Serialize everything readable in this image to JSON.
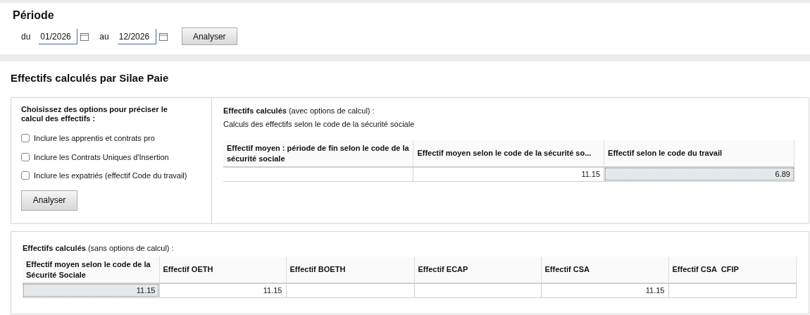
{
  "period": {
    "title": "Période",
    "from_label": "du",
    "from_value": "01/2026",
    "to_label": "au",
    "to_value": "12/2026",
    "button": "Analyser"
  },
  "section_title": "Effectifs calculés par Silae Paie",
  "options": {
    "title": "Choisissez des options pour préciser le calcul des effectifs :",
    "items": [
      {
        "label": "Inclure les apprentis et contrats pro",
        "checked": false
      },
      {
        "label": "Inclure les Contrats Uniques d'Insertion",
        "checked": false
      },
      {
        "label": "Inclure les expatriés (effectif Code du travail)",
        "checked": false
      }
    ],
    "button": "Analyser"
  },
  "with_options": {
    "title": "**Effectifs calculés**  (avec options de calcul) :",
    "subtitle": "Calculs des effectifs selon le code de la sécurité sociale",
    "columns": [
      "Effectif moyen : période de fin selon le code de la sécurité sociale",
      "Effectif moyen selon le code de la sécurité so...",
      "Effectif selon le code du travail"
    ],
    "row": [
      {
        "selected": false
      },
      {
        "value": "11.15",
        "selected": false
      },
      {
        "value": "6.89",
        "selected": true
      }
    ]
  },
  "without_options": {
    "title": "**Effectifs calculés**  (sans options de calcul) :",
    "columns": [
      "Effectif moyen selon le code de la Sécurité Sociale",
      "Effectif OETH",
      "Effectif BOETH",
      "Effectif ECAP",
      "Effectif CSA",
      "Effectif CSA  CFIP"
    ],
    "row": [
      {
        "value": "11.15",
        "selected": true
      },
      {
        "value": "11.15",
        "selected": false
      },
      {
        "selected": false
      },
      {
        "selected": false
      },
      {
        "value": "11.15",
        "selected": false
      },
      {
        "selected": false
      }
    ]
  }
}
